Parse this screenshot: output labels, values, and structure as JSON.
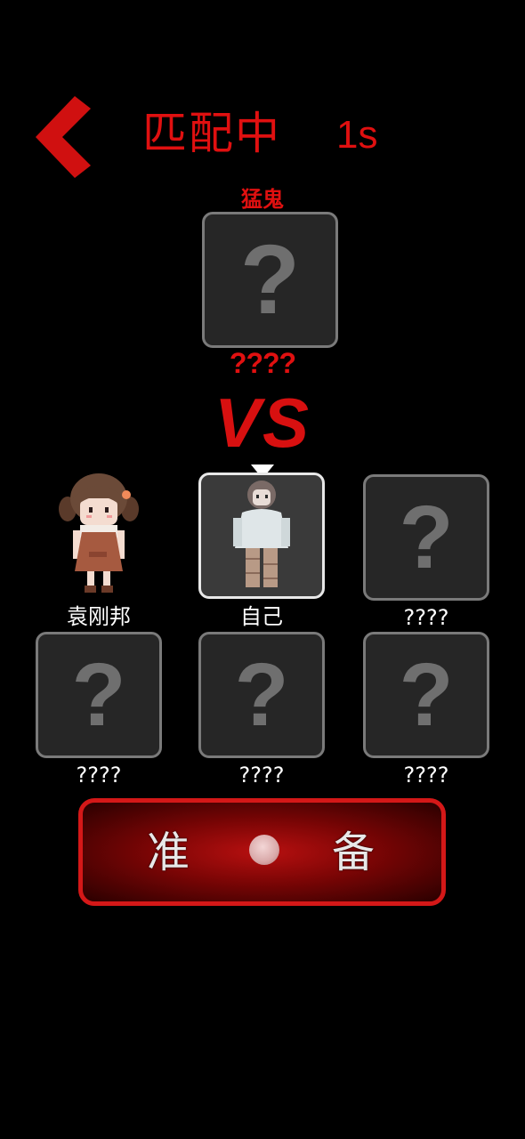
{
  "header": {
    "title": "匹配中",
    "timer": "1s"
  },
  "hunter": {
    "role_label": "猛鬼",
    "placeholder": "?",
    "name": "????"
  },
  "vs_text": "VS",
  "players": [
    {
      "name": "袁刚邦",
      "type": "character-girl"
    },
    {
      "name": "自己",
      "type": "character-self"
    },
    {
      "name": "????",
      "placeholder": "?"
    },
    {
      "name": "????",
      "placeholder": "?"
    },
    {
      "name": "????",
      "placeholder": "?"
    },
    {
      "name": "????",
      "placeholder": "?"
    }
  ],
  "ready_button": {
    "left_char": "准",
    "right_char": "备"
  },
  "colors": {
    "accent_red": "#e01010",
    "card_border": "#7a7a7a",
    "card_bg": "#262626"
  }
}
